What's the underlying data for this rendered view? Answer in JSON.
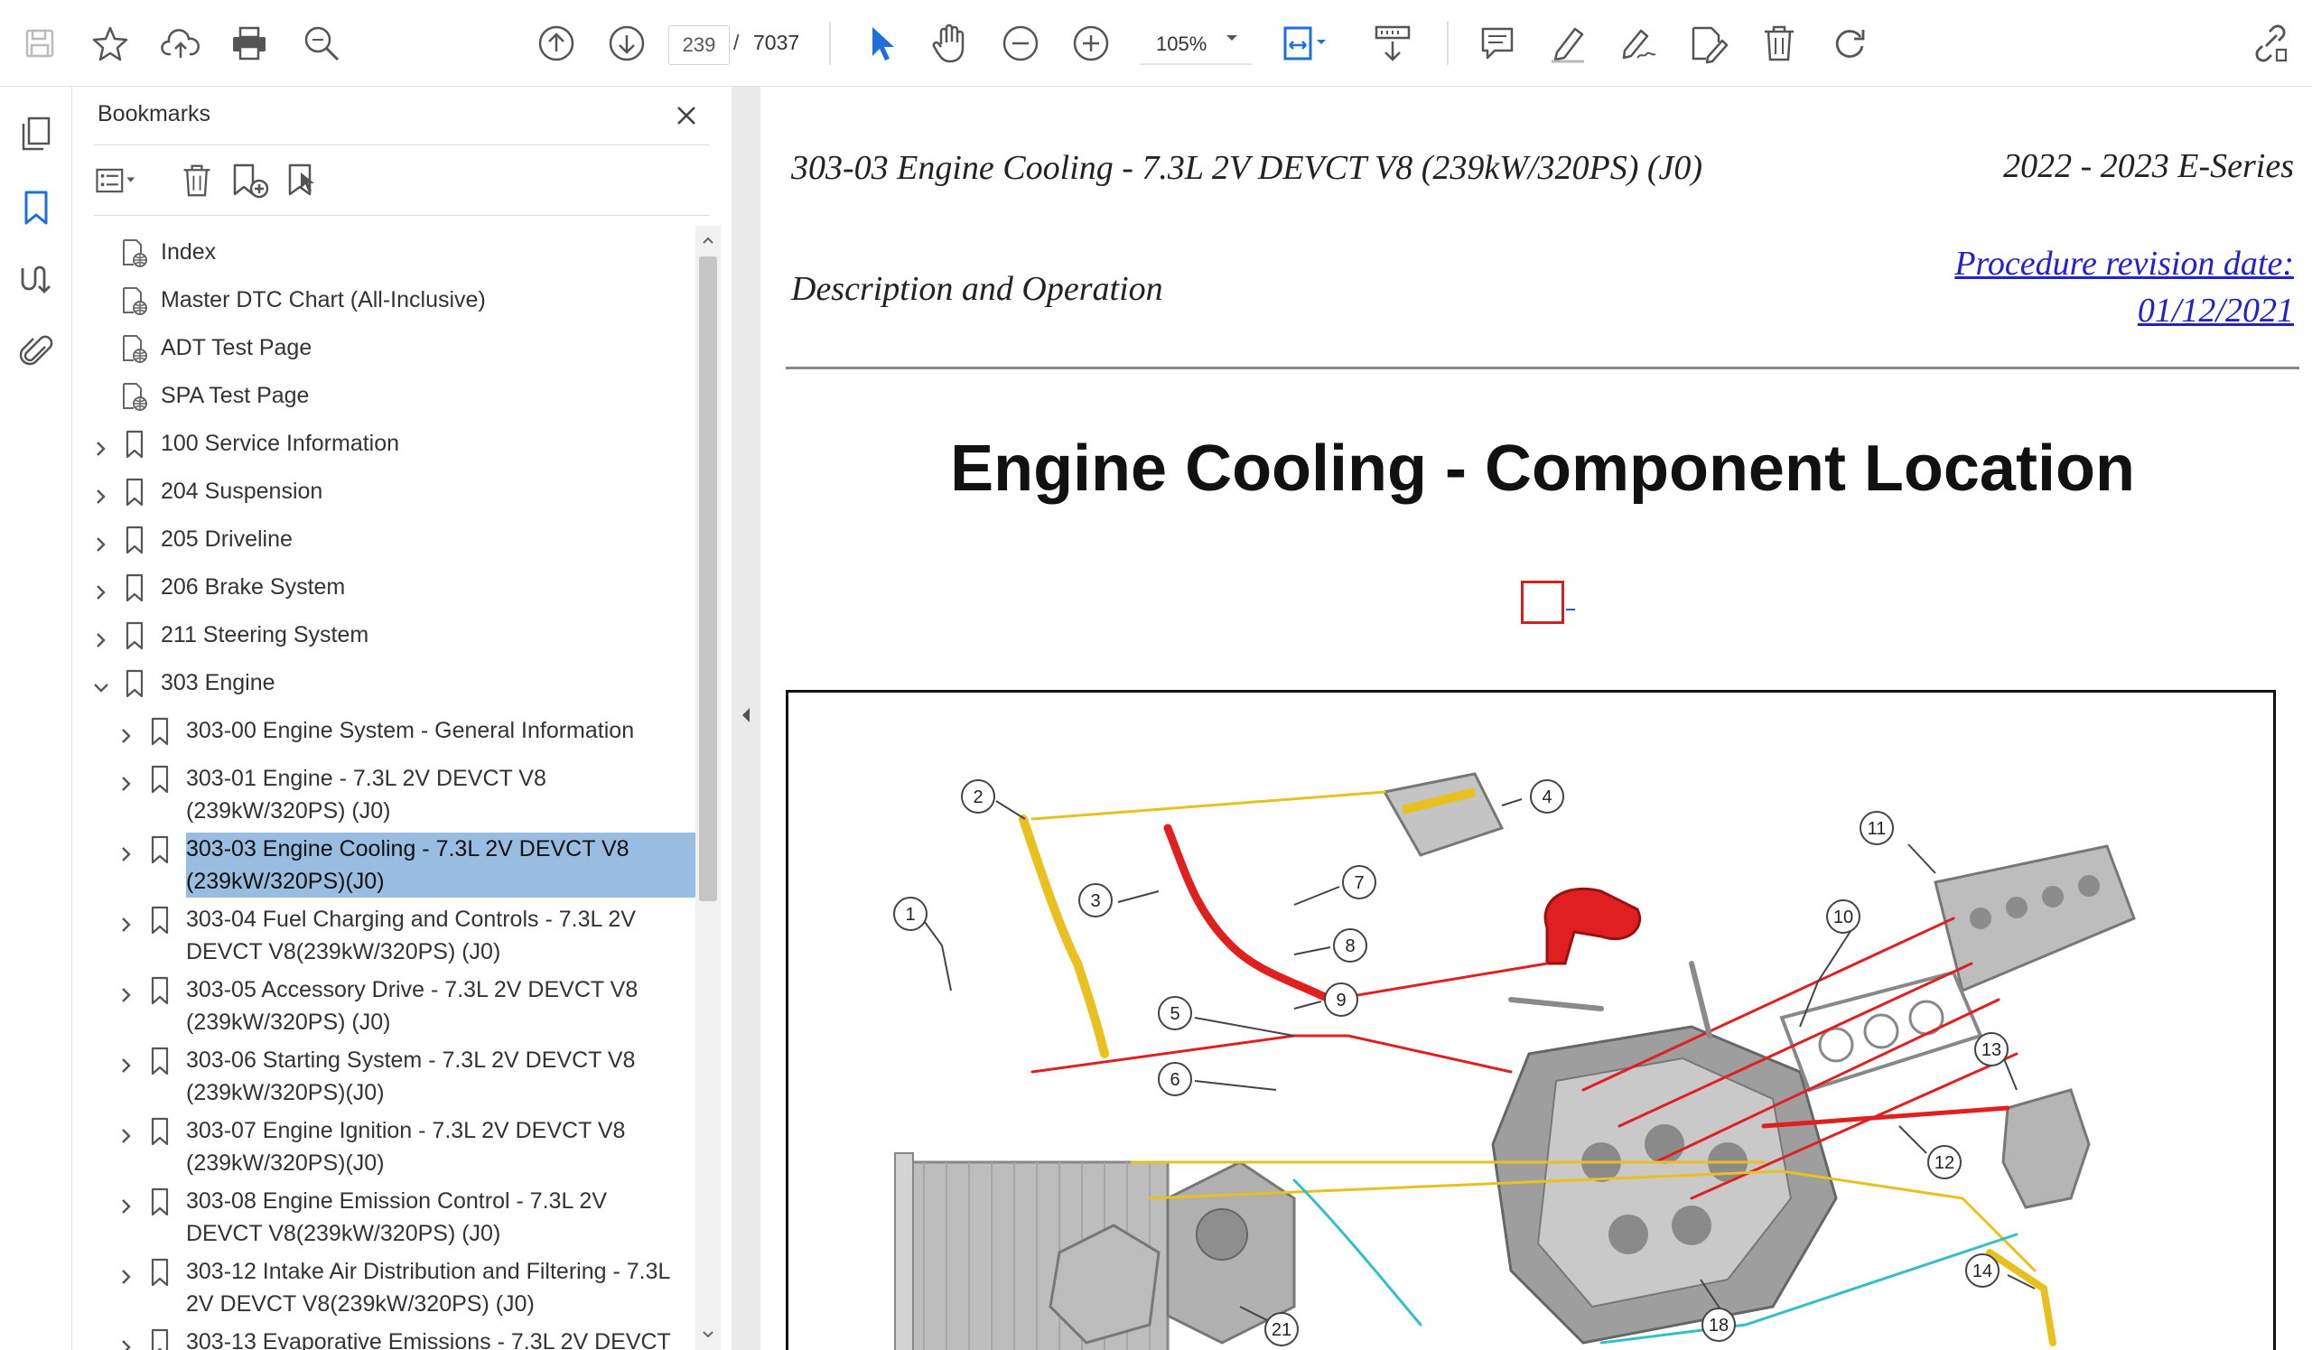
{
  "toolbar": {
    "current_page": "239",
    "page_separator": "/",
    "total_pages": "7037",
    "zoom": "105%"
  },
  "panel": {
    "title": "Bookmarks"
  },
  "bookmarks": [
    {
      "label": "Index"
    },
    {
      "label": "Master DTC Chart (All-Inclusive)"
    },
    {
      "label": "ADT Test Page"
    },
    {
      "label": "SPA Test Page"
    },
    {
      "label": "100 Service Information"
    },
    {
      "label": "204 Suspension"
    },
    {
      "label": "205 Driveline"
    },
    {
      "label": "206 Brake System"
    },
    {
      "label": "211 Steering System"
    },
    {
      "label": "303 Engine"
    },
    {
      "label": "303-00 Engine System - General Information"
    },
    {
      "label": "303-01 Engine - 7.3L 2V DEVCT V8 (239kW/320PS) (J0)"
    },
    {
      "label": "303-03 Engine Cooling - 7.3L 2V DEVCT V8 (239kW/320PS)(J0)"
    },
    {
      "label": "303-04 Fuel Charging and Controls - 7.3L 2V DEVCT V8(239kW/320PS) (J0)"
    },
    {
      "label": "303-05 Accessory Drive - 7.3L 2V DEVCT V8 (239kW/320PS) (J0)"
    },
    {
      "label": "303-06 Starting System - 7.3L 2V DEVCT V8 (239kW/320PS)(J0)"
    },
    {
      "label": "303-07 Engine Ignition - 7.3L 2V DEVCT V8 (239kW/320PS)(J0)"
    },
    {
      "label": "303-08 Engine Emission Control - 7.3L 2V DEVCT V8(239kW/320PS) (J0)"
    },
    {
      "label": "303-12 Intake Air Distribution and Filtering - 7.3L 2V DEVCT V8(239kW/320PS) (J0)"
    },
    {
      "label": "303-13 Evaporative Emissions - 7.3L 2V DEVCT"
    }
  ],
  "document": {
    "title": "303-03 Engine Cooling - 7.3L 2V DEVCT V8 (239kW/320PS) (J0)",
    "series": "2022 - 2023 E-Series",
    "section": "Description and Operation",
    "revision_label": "Procedure revision date:",
    "revision_date": "01/12/2021",
    "heading": "Engine Cooling - Component Location"
  },
  "diagram": {
    "callouts": [
      "1",
      "2",
      "3",
      "4",
      "5",
      "6",
      "7",
      "8",
      "9",
      "10",
      "11",
      "12",
      "13",
      "14",
      "18",
      "21"
    ]
  },
  "colors": {
    "selection": "#98bde0",
    "link": "#2222cc",
    "icon_blue": "#1e6fd9",
    "hose_red": "#e02020",
    "hose_yellow": "#e8c020",
    "hose_cyan": "#30c0c8"
  }
}
